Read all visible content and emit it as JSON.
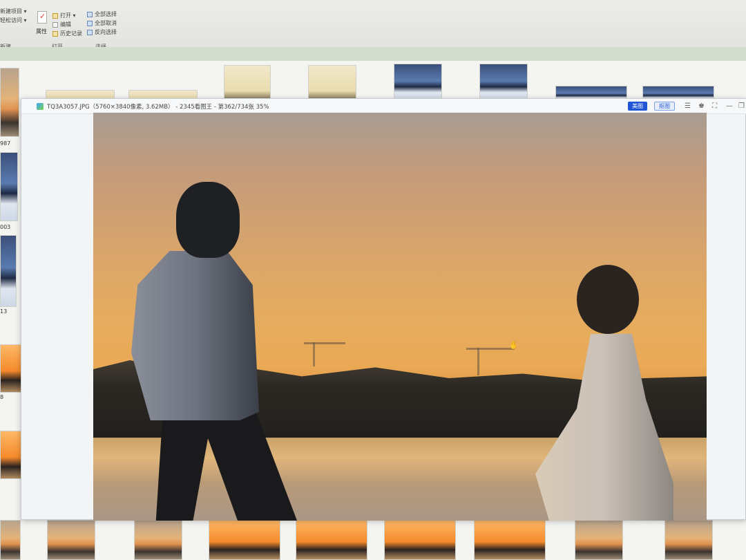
{
  "ribbon": {
    "new_group": {
      "items": [
        "新建项目 ▾",
        "轻松访问 ▾"
      ],
      "label": "新建"
    },
    "open_group": {
      "properties_label": "属性",
      "items": [
        "打开 ▾",
        "编辑",
        "历史记录"
      ],
      "label": "打开"
    },
    "select_group": {
      "items": [
        "全部选择",
        "全部取消",
        "反向选择"
      ],
      "label": "选择"
    }
  },
  "browser": {
    "file_labels": [
      "987",
      "003",
      "13",
      "8"
    ]
  },
  "viewer": {
    "title": "TQ3A3057.JPG（5760×3840像素, 3.62MB） - 2345看图王 - 第362/734张 35%",
    "buttons": {
      "meitu": "美图",
      "koutu": "抠图"
    },
    "controls": {
      "menu": "☰",
      "skin": "♚",
      "fullscreen": "⛶",
      "minimize": "—",
      "restore": "❐"
    }
  },
  "colors": {
    "meitu_bg": "#1e56d6",
    "sunset": "#e6ac5e"
  }
}
